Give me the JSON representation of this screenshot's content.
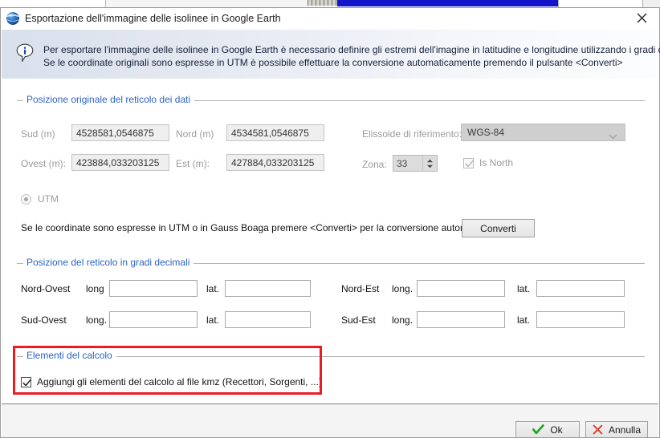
{
  "window": {
    "title": "Esportazione dell'immagine delle isolinee in Google Earth",
    "icon": "google-earth-globe-icon",
    "close_label": "✕"
  },
  "banner": {
    "icon": "info-balloon-icon",
    "line1": "Per esportare l'immagine delle isolinee in Google Earth è necessario definire gli estremi dell'imagine in latitudine e longitudine utilizzando i gradi decimali.",
    "line2": "Se le coordinate originali sono espresse in UTM è possibile effettuare la conversione automaticamente premendo il pulsante <Converti>"
  },
  "original_grid": {
    "title": "Posizione originale del reticolo dei dati",
    "sud_label": "Sud (m)",
    "sud_value": "4528581,0546875",
    "nord_label": "Nord (m)",
    "nord_value": "4534581,0546875",
    "ovest_label": "Ovest (m):",
    "ovest_value": "423884,033203125",
    "est_label": "Est (m):",
    "est_value": "427884,033203125",
    "ellissoide_label": "Elissoide di riferimento:",
    "ellissoide_value": "WGS-84",
    "zona_label": "Zona:",
    "zona_value": "33",
    "is_north_label": "Is North",
    "is_north_checked": true,
    "utm_label": "UTM",
    "utm_selected": true,
    "convert_hint": "Se le coordinate sono espresse in UTM o in Gauss Boaga premere <Converti> per la conversione automatica -->",
    "convert_button": "Converti"
  },
  "decimal_grid": {
    "title": "Posizione del reticolo in gradi decimali",
    "rows": [
      {
        "left_label": "Nord-Ovest",
        "left_long_label": "long",
        "left_long_value": "",
        "left_lat_label": "lat.",
        "left_lat_value": "",
        "right_label": "Nord-Est",
        "right_long_label": "long.",
        "right_long_value": "",
        "right_lat_label": "lat.",
        "right_lat_value": ""
      },
      {
        "left_label": "Sud-Ovest",
        "left_long_label": "long.",
        "left_long_value": "",
        "left_lat_label": "lat.",
        "left_lat_value": "",
        "right_label": "Sud-Est",
        "right_long_label": "long.",
        "right_long_value": "",
        "right_lat_label": "lat.",
        "right_lat_value": ""
      }
    ]
  },
  "calc_elements": {
    "title": "Elementi del calcolo",
    "checkbox_label": "Aggiungi gli elementi del calcolo al file kmz (Recettori, Sorgenti, ...)",
    "checkbox_checked": true,
    "highlight_color": "#ed1c24"
  },
  "footer": {
    "ok_label": "Ok",
    "ok_icon": "green-check-icon",
    "cancel_label": "Annulla",
    "cancel_icon": "red-x-icon"
  },
  "colors": {
    "group_title": "#2a63c4",
    "banner_start": "#d9e0ec",
    "banner_end": "#fcfdfe",
    "ok_green": "#17a81a",
    "cancel_red": "#e03b2a"
  }
}
